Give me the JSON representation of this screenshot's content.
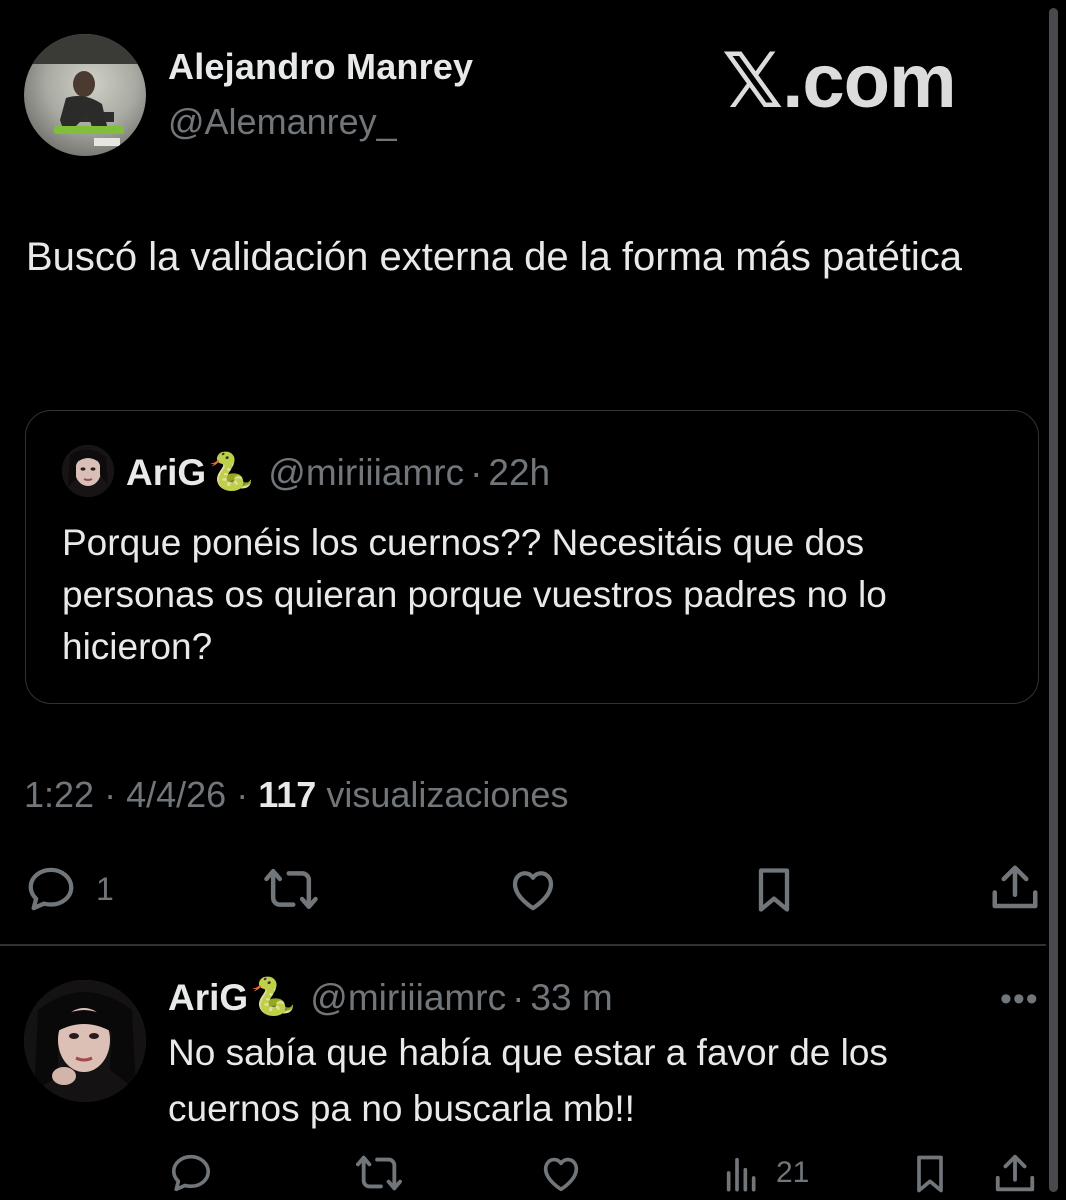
{
  "watermark": "𝕏.com",
  "tweet": {
    "author_name": "Alejandro Manrey",
    "author_handle": "@Alemanrey_",
    "text": "Buscó la validación externa de la forma más patética",
    "time": "1:22",
    "date": "4/4/26",
    "views_count": "117",
    "views_label": "visualizaciones",
    "reply_count": "1",
    "separator": "·"
  },
  "quote": {
    "author_name": "AriG",
    "author_emoji": "🐍",
    "author_handle": "@miriiiamrc",
    "time": "22h",
    "text": "Porque ponéis los cuernos?? Necesitáis que dos personas os quieran porque vuestros padres no lo hicieron?"
  },
  "reply": {
    "author_name": "AriG",
    "author_emoji": "🐍",
    "author_handle": "@miriiiamrc",
    "time": "33 m",
    "text": "No sabía que había que estar a favor de los cuernos pa no buscarla mb!!",
    "views_count": "21",
    "more_label": "•••"
  },
  "icons": {
    "reply": "reply-icon",
    "retweet": "retweet-icon",
    "like": "heart-icon",
    "bookmark": "bookmark-icon",
    "share": "share-icon",
    "views": "views-icon",
    "more": "more-icon"
  },
  "colors": {
    "background": "#000000",
    "text": "#e7e9ea",
    "muted": "#71767b",
    "border": "#2f3336",
    "snake": "#8bc34a"
  }
}
